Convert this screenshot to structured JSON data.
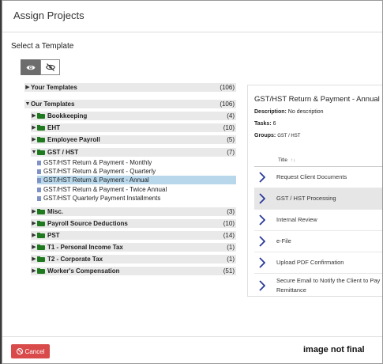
{
  "dialog": {
    "title": "Assign Projects"
  },
  "select_template_label": "Select a Template",
  "toggle": {
    "active_icon": "eye-icon",
    "inactive_icon": "eye-slash-icon"
  },
  "tree": {
    "your_templates": {
      "label": "Your Templates",
      "count": "(106)"
    },
    "our_templates": {
      "label": "Our Templates",
      "count": "(106)"
    },
    "folders": [
      {
        "label": "Bookkeeping",
        "count": "(4)"
      },
      {
        "label": "EHT",
        "count": "(10)"
      },
      {
        "label": "Employee Payroll",
        "count": "(5)"
      },
      {
        "label": "GST / HST",
        "count": "(7)"
      },
      {
        "label": "Misc.",
        "count": "(3)"
      },
      {
        "label": "Payroll Source Deductions",
        "count": "(10)"
      },
      {
        "label": "PST",
        "count": "(14)"
      },
      {
        "label": "T1 - Personal Income Tax",
        "count": "(1)"
      },
      {
        "label": "T2 - Corporate Tax",
        "count": "(1)"
      },
      {
        "label": "Worker's Compensation",
        "count": "(51)"
      }
    ],
    "gst_items": [
      "GST/HST Return & Payment - Monthly",
      "GST/HST Return & Payment - Quarterly",
      "GST/HST Return & Payment - Annual",
      "GST/HST Return & Payment - Twice Annual",
      "GST/HST Quarterly Payment Installments"
    ]
  },
  "detail": {
    "title": "GST/HST Return & Payment - Annual",
    "description_label": "Description:",
    "description_value": "No description",
    "tasks_label": "Tasks:",
    "tasks_value": "6",
    "groups_label": "Groups:",
    "groups_value": "GST / HST",
    "column_title": "Title",
    "sort_icon": "↑↓",
    "tasks": [
      "Request Client Documents",
      "GST / HST Processing",
      "Internal Review",
      "e-File",
      "Upload PDF Confirmation",
      "Secure Email to Notify the Client to Pay",
      "Remittance"
    ]
  },
  "footer": {
    "cancel_label": "Cancel",
    "note": "image not final"
  },
  "colors": {
    "folder": "#1f7a1f",
    "selected_row": "#b8d7ea",
    "cancel_button": "#d94a4a",
    "chevron": "#2a3a9a"
  }
}
